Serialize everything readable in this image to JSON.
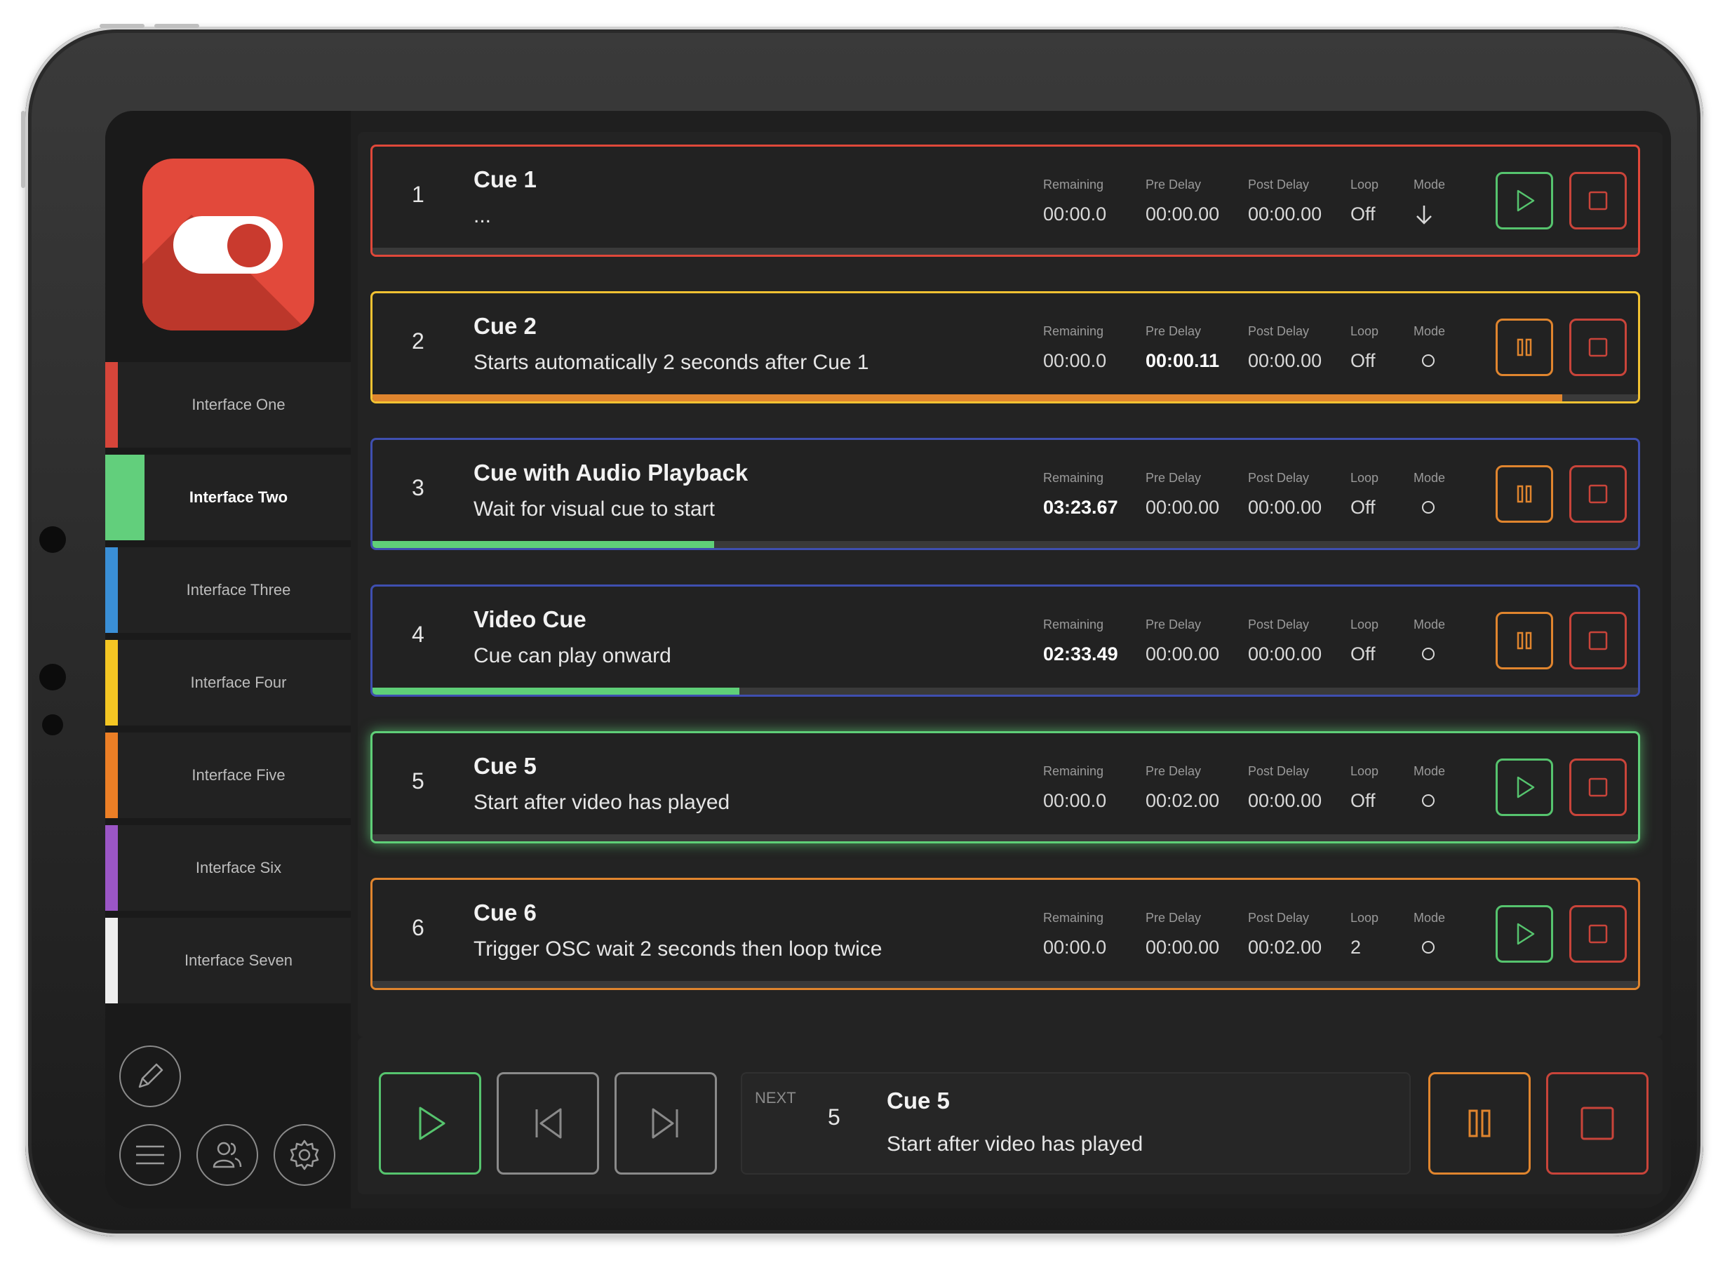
{
  "app": {
    "icon_name": "toggle-switch-icon",
    "accent": "#e2493b"
  },
  "colors": {
    "red": "#e0483a",
    "yellow": "#f2c232",
    "blue": "#3f4fb0",
    "green": "#5fcf78",
    "orange": "#e0852e",
    "play_green": "#56c46e",
    "pause_orange": "#e0852e",
    "stop_red": "#c9443a",
    "gray": "#8a8a8a"
  },
  "sidebar": {
    "items": [
      {
        "label": "Interface One",
        "color": "#d6453a"
      },
      {
        "label": "Interface Two",
        "color": "#62cf7c"
      },
      {
        "label": "Interface Three",
        "color": "#3a8fd6"
      },
      {
        "label": "Interface Four",
        "color": "#f4c623"
      },
      {
        "label": "Interface Five",
        "color": "#ec7f26"
      },
      {
        "label": "Interface Six",
        "color": "#9b56c6"
      },
      {
        "label": "Interface Seven",
        "color": "#eeeeee"
      }
    ],
    "active_index": 1,
    "bottom_icons": [
      "pencil-icon",
      "menu-icon",
      "users-icon",
      "gear-icon"
    ]
  },
  "columns": {
    "remaining": "Remaining",
    "pre_delay": "Pre Delay",
    "post_delay": "Post Delay",
    "loop": "Loop",
    "mode": "Mode"
  },
  "cues": [
    {
      "number": "1",
      "title": "Cue 1",
      "description": "...",
      "remaining": "00:00.0",
      "pre_delay": "00:00.00",
      "post_delay": "00:00.00",
      "loop": "Off",
      "mode_icon": "arrow-down-icon",
      "border": "#e0483a",
      "progress": 0,
      "progress_color": "#5fcf78",
      "state": "play",
      "bold_field": ""
    },
    {
      "number": "2",
      "title": "Cue 2",
      "description": "Starts automatically 2 seconds after Cue 1",
      "remaining": "00:00.0",
      "pre_delay": "00:00.11",
      "post_delay": "00:00.00",
      "loop": "Off",
      "mode_icon": "circle-icon",
      "border": "#f2c232",
      "progress": 0.94,
      "progress_color": "#e0852e",
      "state": "pause",
      "bold_field": "pre_delay"
    },
    {
      "number": "3",
      "title": "Cue with Audio Playback",
      "description": "Wait for visual cue to start",
      "remaining": "03:23.67",
      "pre_delay": "00:00.00",
      "post_delay": "00:00.00",
      "loop": "Off",
      "mode_icon": "circle-icon",
      "border": "#3f4fb0",
      "progress": 0.27,
      "progress_color": "#5fcf78",
      "state": "pause",
      "bold_field": "remaining"
    },
    {
      "number": "4",
      "title": "Video Cue",
      "description": "Cue can play onward",
      "remaining": "02:33.49",
      "pre_delay": "00:00.00",
      "post_delay": "00:00.00",
      "loop": "Off",
      "mode_icon": "circle-icon",
      "border": "#3f4fb0",
      "progress": 0.29,
      "progress_color": "#5fcf78",
      "state": "pause",
      "bold_field": "remaining"
    },
    {
      "number": "5",
      "title": "Cue 5",
      "description": "Start after video has played",
      "remaining": "00:00.0",
      "pre_delay": "00:02.00",
      "post_delay": "00:00.00",
      "loop": "Off",
      "mode_icon": "circle-icon",
      "border": "#5fcf78",
      "progress": 0,
      "progress_color": "#5fcf78",
      "state": "play",
      "bold_field": "",
      "glow": true
    },
    {
      "number": "6",
      "title": "Cue 6",
      "description": "Trigger OSC wait 2 seconds then loop twice",
      "remaining": "00:00.0",
      "pre_delay": "00:00.00",
      "post_delay": "00:02.00",
      "loop": "2",
      "mode_icon": "circle-icon",
      "border": "#e0852e",
      "progress": 0,
      "progress_color": "#5fcf78",
      "state": "play",
      "bold_field": ""
    }
  ],
  "transport": {
    "next_label": "NEXT",
    "next_number": "5",
    "next_title": "Cue 5",
    "next_description": "Start after video has played",
    "buttons": [
      "play-icon",
      "skip-back-icon",
      "skip-forward-icon",
      "pause-icon",
      "stop-icon"
    ]
  }
}
